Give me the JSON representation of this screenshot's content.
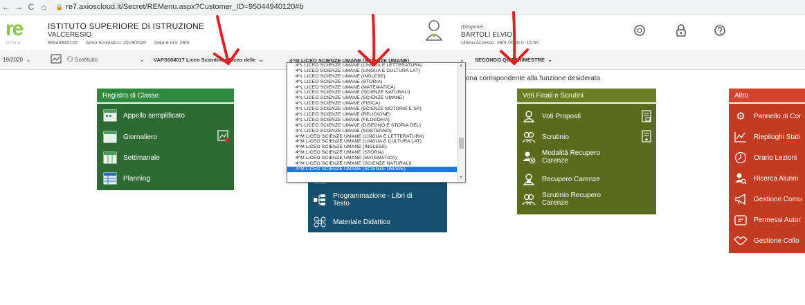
{
  "browser": {
    "back": "←",
    "forward": "→",
    "reload": "C",
    "home": "⌂",
    "url": "re7.axioscloud.it/Secret/REMenu.aspx?Customer_ID=95044940120#b"
  },
  "header": {
    "logo_text": "re",
    "logo_sub": "17.07.0.0",
    "school_name": "ISTITUTO SUPERIORE DI ISTRUZIONE",
    "school_city": "VALCERESIO",
    "school_code": "95044940120",
    "school_year": "Anno Scolastico: 2019/2020",
    "date_label": "Data e ora: 28/0",
    "user_role": "(Dirigente)",
    "user_name": "BARTOLI ELVIO",
    "last_access": "Ultimo Accesso: 28/0  /2020 0 .15.55"
  },
  "toolbar": {
    "year": "19/2020",
    "substitute": "Sostituito",
    "school_select": "VAPS004017 Liceo Scientifico Liceo delle",
    "class_select": "4^M LICEO SCIENZE UMANE (SCIENZE UMANE)",
    "period_select": "SECONDO QUADRIMESTRE"
  },
  "instruction": "ona corrispondente alla funzione desiderata",
  "dropdown": {
    "options": [
      "4^L LICEO SCIENZE UMANE (LINGUA E LETTERATURA)",
      "4^L LICEO SCIENZE UMANE (LINGUA E CULTURA LAT)",
      "4^L LICEO SCIENZE UMANE (INGLESE)",
      "4^L LICEO SCIENZE UMANE (STORIA)",
      "4^L LICEO SCIENZE UMANE (MATEMATICA)",
      "4^L LICEO SCIENZE UMANE (SCIENZE NATURALI)",
      "4^L LICEO SCIENZE UMANE (SCIENZE UMANE)",
      "4^L LICEO SCIENZE UMANE (FISICA)",
      "4^L LICEO SCIENZE UMANE (SCIENZE MOTORIE E SP)",
      "4^L LICEO SCIENZE UMANE (RELIGIONE)",
      "4^L LICEO SCIENZE UMANE (FILOSOFIA)",
      "4^L LICEO SCIENZE UMANE (DISEGNO E STORIA DEL)",
      "4^L LICEO SCIENZE UMANE (SOSTEGNO)",
      "4^M LICEO SCIENZE UMANE (LINGUA E LETTERATURA)",
      "4^M LICEO SCIENZE UMANE (LINGUA E CULTURA LAT)",
      "4^M LICEO SCIENZE UMANE (INGLESE)",
      "4^M LICEO SCIENZE UMANE (STORIA)",
      "4^M LICEO SCIENZE UMANE (MATEMATICA)",
      "4^M LICEO SCIENZE UMANE (SCIENZE NATURALI)",
      "4^M LICEO SCIENZE UMANE (SCIENZE UMANE)"
    ],
    "selected_index": 19
  },
  "registro": {
    "title": "Registro di Classe",
    "items": [
      "Appello semplificato",
      "Giornaliero",
      "Settimanale",
      "Planning"
    ]
  },
  "didattica": {
    "items": [
      "Programmazione - Libri di Testo",
      "Materiale Didattico"
    ]
  },
  "voti": {
    "title": "Voti Finali e Scrutini",
    "items": [
      "Voti Proposti",
      "Scrutinio",
      "Modalità Recupero Carenze",
      "Recupero Carenze",
      "Scrutinio Recupero Carenze"
    ]
  },
  "altro": {
    "title": "Altro",
    "items": [
      "Pannello di Cor",
      "Riepiloghi Stati",
      "Orario Lezioni",
      "Ricerca Alunni",
      "Gestione Comu",
      "Permessi Autor",
      "Gestione Collo"
    ]
  },
  "colors": {
    "green": "#2e6b34",
    "green_head": "#2e8b3e",
    "blue": "#15506e",
    "olive": "#5b6b1e",
    "red": "#c23b22",
    "arrow": "#e02020"
  }
}
